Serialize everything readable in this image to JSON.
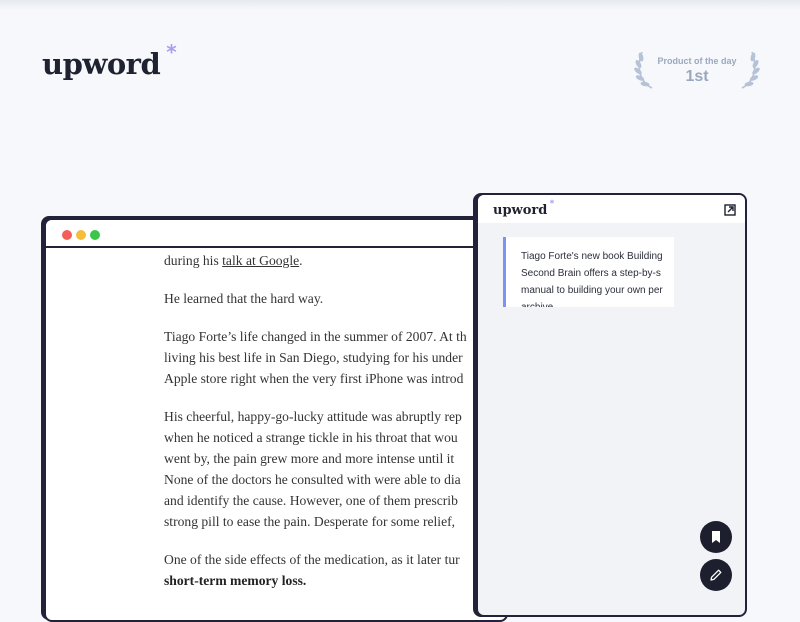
{
  "brand": {
    "name": "upword",
    "star": "*"
  },
  "award": {
    "caption": "Product of the day",
    "rank": "1st"
  },
  "browser": {
    "article": [
      {
        "segments": [
          {
            "t": "during his "
          },
          {
            "t": "talk at Google",
            "style": "link"
          },
          {
            "t": "."
          }
        ]
      },
      {
        "segments": [
          {
            "t": "He learned that the hard way."
          }
        ]
      },
      {
        "lines": [
          "Tiago Forte’s life changed in the summer of 2007. At th",
          "living his best life in San Diego, studying for his under",
          "Apple store right when the very first iPhone was introd"
        ]
      },
      {
        "lines": [
          "His cheerful, happy-go-lucky attitude was abruptly rep",
          "when he noticed a strange tickle in his throat that wou",
          "went by, the pain grew more and more intense until it",
          "None of the doctors he consulted with were able to dia",
          "and identify the cause. However, one of them prescrib",
          "strong pill to ease the pain. Desperate for some relief,"
        ]
      },
      {
        "lines": [
          "One of the side effects of the medication, as it later tur"
        ],
        "bold": "short-term memory loss."
      }
    ]
  },
  "panel": {
    "logo": "upword",
    "summary_lines": [
      "Tiago Forte's new book Building",
      "Second Brain offers a step-by-s",
      "manual to building your own per",
      "archive"
    ]
  },
  "colors": {
    "accent": "#7b93f5",
    "star": "#a99cf2",
    "dark": "#1d1f2e"
  }
}
